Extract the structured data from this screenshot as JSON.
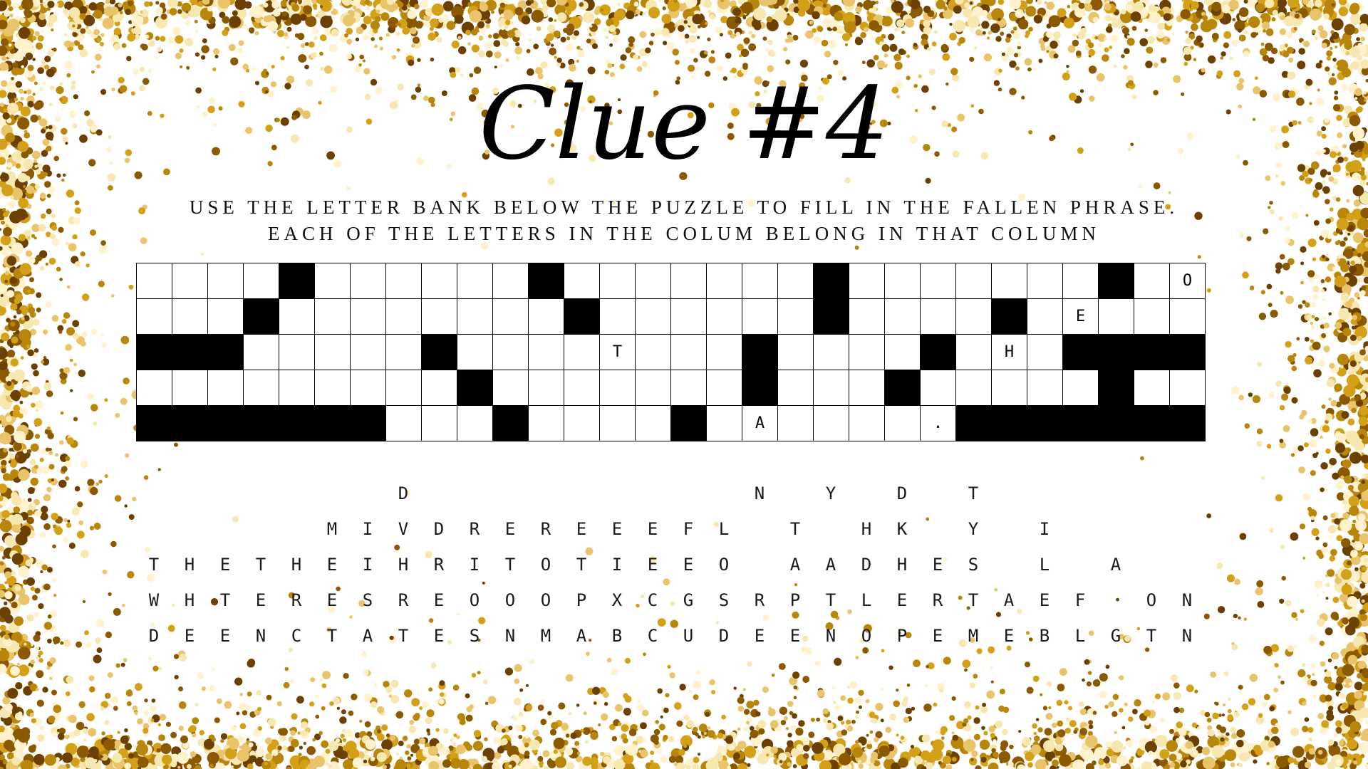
{
  "title": "Clue #4",
  "instructions": {
    "line1": "USE THE LETTER BANK BELOW THE PUZZLE TO FILL IN THE FALLEN PHRASE.",
    "line2": "EACH OF THE LETTERS IN THE COLUM BELONG IN THAT COLUMN"
  },
  "colors": {
    "confetti": [
      "#f7e7b0",
      "#e9c46a",
      "#d4a017",
      "#b8860b",
      "#8b5a00",
      "#6b4000",
      "#fff2cc"
    ]
  },
  "puzzle": {
    "columns": 30,
    "rows": [
      "....#......#.........#.......#O",
      "...#.......#.........#....#.E..",
      "###.....#.....T...#.....#..H.###",
      "...........#........#.........#..",
      "#######...#.....#..A......."
    ]
  },
  "letter_bank": {
    "rows": [
      "       D         N Y D T      ",
      "     MIVDREREEEFL T HK Y I    ",
      "THETHEIHRITOTIEEO AADHES L A  ",
      "WHTERESREOOOPXCGSRPTLERTAEF ON",
      "DEENCTATESNMABCUDEENOPEMEBLGTN"
    ]
  }
}
